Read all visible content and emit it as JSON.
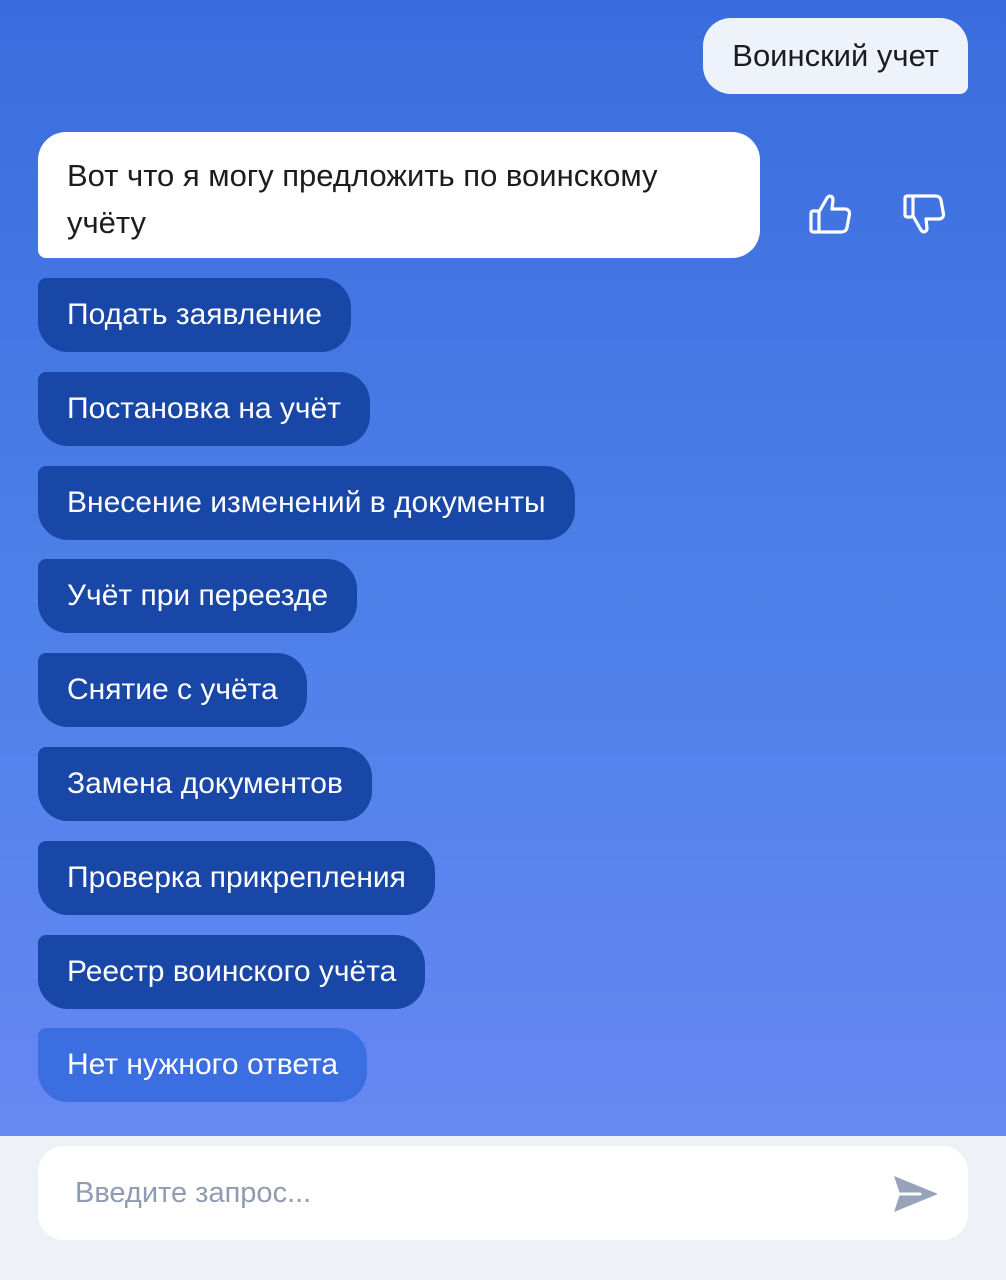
{
  "user_message": {
    "text": "Воинский учет"
  },
  "bot_message": {
    "text": "Вот что я могу предложить по воинскому учёту"
  },
  "feedback": {
    "like_icon": "thumbs-up-icon",
    "dislike_icon": "thumbs-down-icon"
  },
  "options": [
    {
      "label": "Подать заявление"
    },
    {
      "label": "Постановка на учёт"
    },
    {
      "label": "Внесение изменений в документы"
    },
    {
      "label": "Учёт при переезде"
    },
    {
      "label": "Снятие с учёта"
    },
    {
      "label": "Замена документов"
    },
    {
      "label": "Проверка прикрепления"
    },
    {
      "label": "Реестр воинского учёта"
    },
    {
      "label": "Нет нужного ответа"
    }
  ],
  "input": {
    "placeholder": "Введите запрос...",
    "value": "",
    "send_icon": "send-icon"
  },
  "colors": {
    "gradient_top": "#3a6cdd",
    "gradient_bottom": "#6688f3",
    "option_pill": "#1947a7",
    "option_pill_alt": "#3b6ee1",
    "bubble_bot": "#ffffff",
    "bubble_user": "#eef2fb",
    "input_background": "#eef1f6"
  }
}
